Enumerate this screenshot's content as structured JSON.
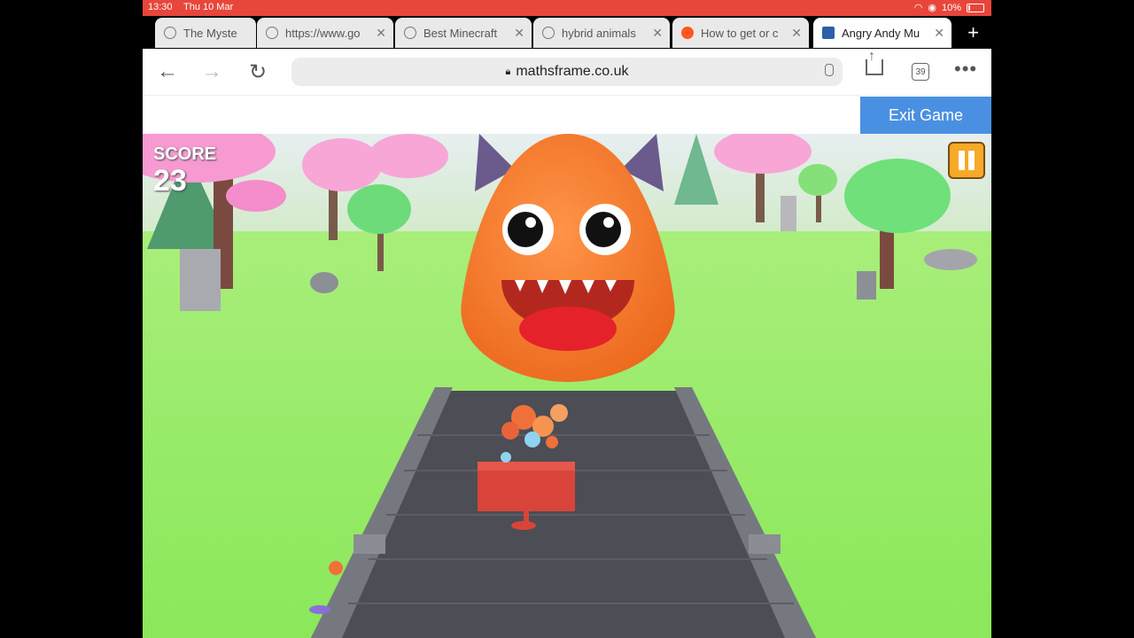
{
  "status_bar": {
    "time": "13:30",
    "date": "Thu 10 Mar",
    "battery": "10%"
  },
  "tabs": [
    {
      "label": "The Myste"
    },
    {
      "label": "https://www.go"
    },
    {
      "label": "Best Minecraft"
    },
    {
      "label": "hybrid animals"
    },
    {
      "label": "How to get or c"
    },
    {
      "label": "Angry Andy Mu",
      "active": true
    }
  ],
  "toolbar": {
    "url": "mathsframe.co.uk",
    "tab_count": "39"
  },
  "page": {
    "exit_button": "Exit Game"
  },
  "game": {
    "score_label": "SCORE",
    "score_value": "23"
  },
  "colors": {
    "status_bar": "#e8463b",
    "exit_button": "#4a90e2",
    "grass": "#8ee85a",
    "monster": "#f47a2a",
    "pause_button": "#f7a928"
  }
}
